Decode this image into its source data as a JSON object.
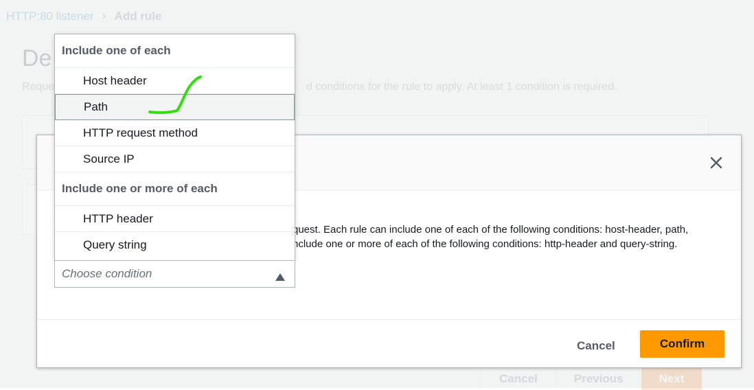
{
  "background": {
    "breadcrumb": {
      "parent": "HTTP:80 listener",
      "current": "Add rule"
    },
    "title": "De",
    "description_left": "Reque",
    "description_right": "d conditions for the rule to apply. At least 1 condition is required.",
    "footer": {
      "cancel": "Cancel",
      "previous": "Previous",
      "next": "Next"
    }
  },
  "modal": {
    "description_line1": "quest. Each rule can include one of each of the following conditions: host-header, path,",
    "description_line2": "nclude one or more of each of the following conditions: http-header and query-string.",
    "cancel_label": "Cancel",
    "confirm_label": "Confirm"
  },
  "dropdown": {
    "groups": [
      {
        "header": "Include one of each",
        "options": [
          "Host header",
          "Path",
          "HTTP request method",
          "Source IP"
        ]
      },
      {
        "header": "Include one or more of each",
        "options": [
          "HTTP header",
          "Query string"
        ]
      }
    ],
    "highlighted": "Path",
    "placeholder": "Choose condition"
  },
  "icons": {
    "close": "close-icon",
    "caret": "caret-up-icon",
    "annotation": "checkmark-annotation"
  },
  "colors": {
    "accent": "#ff9900",
    "link": "#0073bb",
    "annotation": "#33dd11"
  }
}
